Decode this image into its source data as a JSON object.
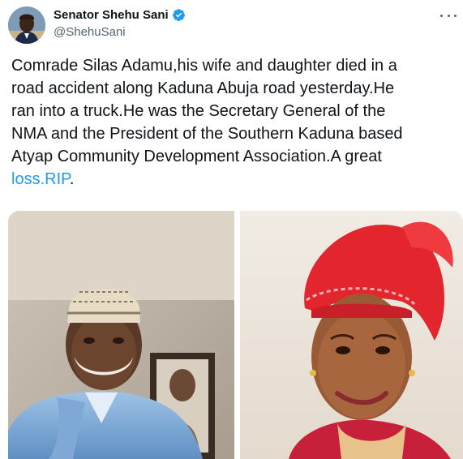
{
  "author": {
    "display_name": "Senator Shehu Sani",
    "handle": "@ShehuSani",
    "verified": true
  },
  "tweet": {
    "lines": [
      "Comrade Silas Adamu,his wife and daughter died in a",
      "road accident along Kaduna Abuja road yesterday.He",
      "ran into a truck.He was the Secretary General of the",
      "NMA and the President of the Southern Kaduna based",
      "Atyap Community Development Association.A great"
    ],
    "last_line_link": "loss.RIP",
    "last_line_suffix": "."
  },
  "media": {
    "left_photo": "man-in-cap-photo",
    "right_photo": "woman-in-red-headtie-photo"
  },
  "colors": {
    "accent": "#1d9bf0",
    "text": "#0f1419",
    "secondary": "#536471"
  },
  "icons": [
    "verified-badge-icon",
    "more-options-icon"
  ]
}
